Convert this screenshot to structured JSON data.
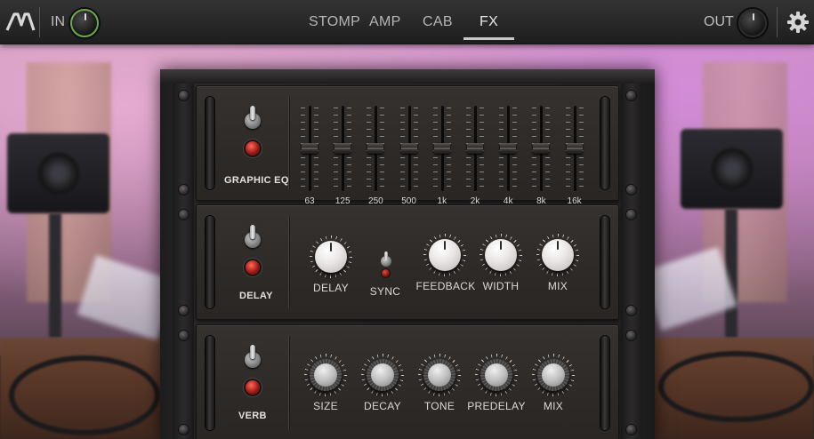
{
  "topbar": {
    "input_label": "IN",
    "output_label": "OUT",
    "tabs": [
      {
        "label": "STOMP",
        "active": false
      },
      {
        "label": "AMP",
        "active": false
      },
      {
        "label": "CAB",
        "active": false
      },
      {
        "label": "FX",
        "active": true
      }
    ],
    "settings_icon": "gear-icon",
    "logo_icon": "brand-logo-icon"
  },
  "rack": {
    "graphic_eq": {
      "title": "GRAPHIC EQ",
      "bands": [
        {
          "label": "63",
          "level": 0.5
        },
        {
          "label": "125",
          "level": 0.5
        },
        {
          "label": "250",
          "level": 0.5
        },
        {
          "label": "500",
          "level": 0.5
        },
        {
          "label": "1k",
          "level": 0.5
        },
        {
          "label": "2k",
          "level": 0.5
        },
        {
          "label": "4k",
          "level": 0.5
        },
        {
          "label": "8k",
          "level": 0.5
        },
        {
          "label": "16k",
          "level": 0.5
        }
      ]
    },
    "delay": {
      "title": "DELAY",
      "knobs": [
        {
          "label": "DELAY"
        },
        {
          "label": "FEEDBACK"
        },
        {
          "label": "WIDTH"
        },
        {
          "label": "MIX"
        }
      ],
      "sync_label": "SYNC"
    },
    "verb": {
      "title": "VERB",
      "knobs": [
        {
          "label": "SIZE"
        },
        {
          "label": "DECAY"
        },
        {
          "label": "TONE"
        },
        {
          "label": "PREDELAY"
        },
        {
          "label": "MIX"
        }
      ]
    }
  },
  "colors": {
    "accent_green": "#6aa84f",
    "led_red": "#c0281c",
    "tab_underline": "#c8c8c8"
  }
}
